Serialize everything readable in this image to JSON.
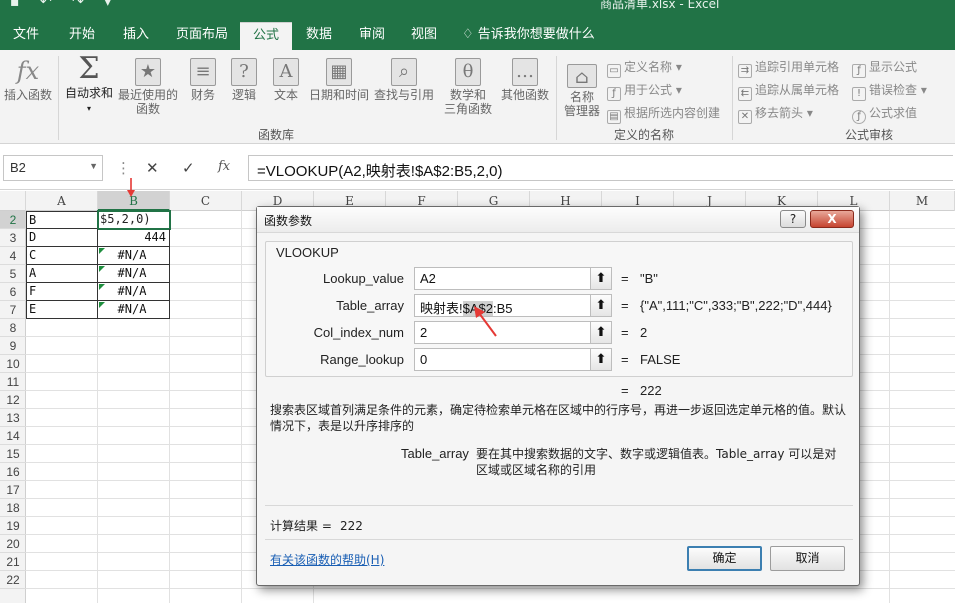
{
  "titlebar": {
    "doc_title": "商品清单.xlsx  -  Excel"
  },
  "tabs": [
    {
      "label": "文件"
    },
    {
      "label": "开始"
    },
    {
      "label": "插入"
    },
    {
      "label": "页面布局"
    },
    {
      "label": "公式"
    },
    {
      "label": "数据"
    },
    {
      "label": "审阅"
    },
    {
      "label": "视图"
    },
    {
      "label": "告诉我你想要做什么"
    }
  ],
  "ribbon": {
    "insert_function": "插入函数",
    "autosum": "自动求和",
    "recent_1": "最近使用的",
    "recent_2": "函数",
    "financial": "财务",
    "logical": "逻辑",
    "text": "文本",
    "datetime": "日期和时间",
    "lookup": "查找与引用",
    "math_1": "数学和",
    "math_2": "三角函数",
    "more": "其他函数",
    "name_mgr_1": "名称",
    "name_mgr_2": "管理器",
    "define_name": "定义名称",
    "use_in_formula": "用于公式",
    "create_from_sel": "根据所选内容创建",
    "trace_precedents": "追踪引用单元格",
    "trace_dependents": "追踪从属单元格",
    "remove_arrows": "移去箭头",
    "show_formulas": "显示公式",
    "error_check": "错误检查",
    "evaluate": "公式求值",
    "group_library": "函数库",
    "group_names": "定义的名称",
    "group_audit": "公式审核"
  },
  "formula_bar": {
    "name_box": "B2",
    "fx": "fx",
    "formula": "=VLOOKUP(A2,映射表!$A$2:B5,2,0)"
  },
  "grid": {
    "columns": [
      "A",
      "B",
      "C",
      "D",
      "E",
      "F",
      "G",
      "H",
      "I",
      "J",
      "K",
      "L",
      "M"
    ],
    "rows": [
      "2",
      "3",
      "4",
      "5",
      "6",
      "7",
      "8",
      "9",
      "10",
      "11",
      "12",
      "13",
      "14",
      "15",
      "16",
      "17",
      "18",
      "19",
      "20",
      "21",
      "22"
    ],
    "edit_cell_text": "$5,2,0)",
    "data": [
      {
        "a": "B",
        "b": ""
      },
      {
        "a": "D",
        "b": "444"
      },
      {
        "a": "C",
        "b": "#N/A"
      },
      {
        "a": "A",
        "b": "#N/A"
      },
      {
        "a": "F",
        "b": "#N/A"
      },
      {
        "a": "E",
        "b": "#N/A"
      }
    ]
  },
  "dialog": {
    "title": "函数参数",
    "help_btn": "?",
    "close_btn": "X",
    "function_name": "VLOOKUP",
    "args": [
      {
        "label": "Lookup_value",
        "value": "A2",
        "result": "\"B\""
      },
      {
        "label": "Table_array",
        "value_pre": "映射表!",
        "value_hl": "$A$2",
        "value_post": ":B5",
        "result": "{\"A\",111;\"C\",333;\"B\",222;\"D\",444}"
      },
      {
        "label": "Col_index_num",
        "value": "2",
        "result": "2"
      },
      {
        "label": "Range_lookup",
        "value": "0",
        "result": "FALSE"
      }
    ],
    "eq": "=",
    "overall_result": "222",
    "description": "搜索表区域首列满足条件的元素，确定待检索单元格在区域中的行序号，再进一步返回选定单元格的值。默认情况下，表是以升序排序的",
    "arg_name": "Table_array",
    "arg_description": "要在其中搜索数据的文字、数字或逻辑值表。Table_array 可以是对区域或区域名称的引用",
    "calc_label": "计算结果 =",
    "calc_value": "222",
    "help_link": "有关该函数的帮助(H)",
    "ok": "确定",
    "cancel": "取消"
  }
}
